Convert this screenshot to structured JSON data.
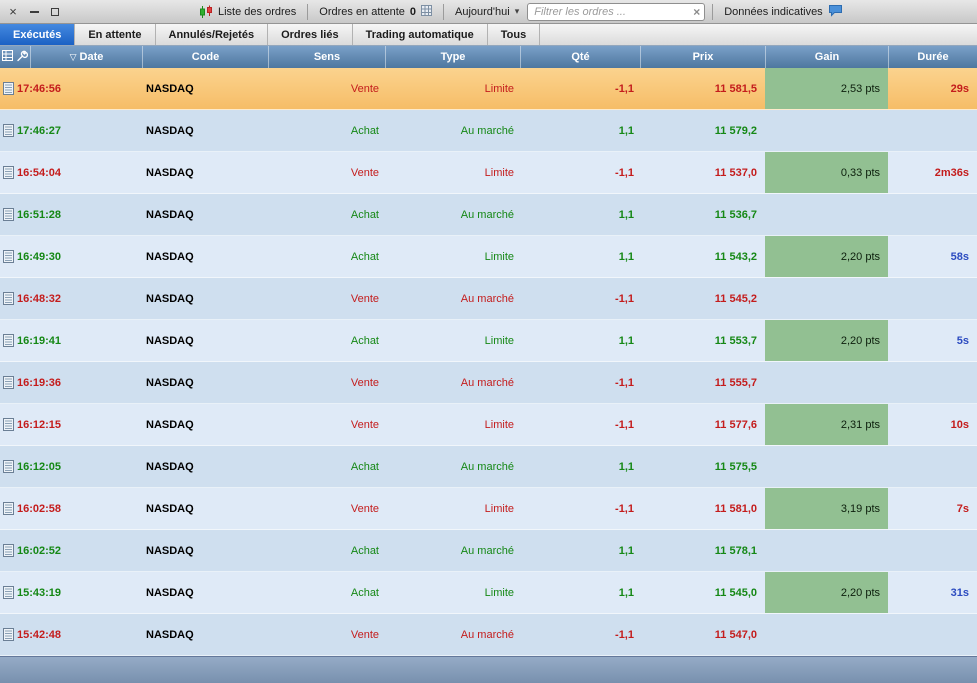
{
  "window": {
    "close_glyph": "×"
  },
  "toolbar": {
    "list_orders_label": "Liste des ordres",
    "pending_label": "Ordres en attente",
    "pending_count": "0",
    "period_label": "Aujourd'hui",
    "period_arrow": "▾",
    "filter_placeholder": "Filtrer les ordres ...",
    "filter_clear_glyph": "×",
    "indicative_label": "Données indicatives"
  },
  "tabs": [
    {
      "id": "executes",
      "label": "Exécutés",
      "active": true
    },
    {
      "id": "en-attente",
      "label": "En attente",
      "active": false
    },
    {
      "id": "annules-rejetes",
      "label": "Annulés/Rejetés",
      "active": false
    },
    {
      "id": "ordres-lies",
      "label": "Ordres liés",
      "active": false
    },
    {
      "id": "trading-automatique",
      "label": "Trading automatique",
      "active": false
    },
    {
      "id": "tous",
      "label": "Tous",
      "active": false
    }
  ],
  "table": {
    "sort_glyph": "▽",
    "columns": [
      {
        "key": "date",
        "label": "Date",
        "sorted": true
      },
      {
        "key": "code",
        "label": "Code"
      },
      {
        "key": "sens",
        "label": "Sens"
      },
      {
        "key": "type",
        "label": "Type"
      },
      {
        "key": "qte",
        "label": "Qté"
      },
      {
        "key": "prix",
        "label": "Prix"
      },
      {
        "key": "gain",
        "label": "Gain"
      },
      {
        "key": "duree",
        "label": "Durée"
      }
    ],
    "rows": [
      {
        "date": "17:46:56",
        "code": "NASDAQ",
        "sens": "Vente",
        "type": "Limite",
        "qte": "-1,1",
        "prix": "11 581,5",
        "gain": "2,53 pts",
        "duree": "29s",
        "side": "sell",
        "selected": true
      },
      {
        "date": "17:46:27",
        "code": "NASDAQ",
        "sens": "Achat",
        "type": "Au marché",
        "qte": "1,1",
        "prix": "11 579,2",
        "gain": "",
        "duree": "",
        "side": "buy",
        "selected": false
      },
      {
        "date": "16:54:04",
        "code": "NASDAQ",
        "sens": "Vente",
        "type": "Limite",
        "qte": "-1,1",
        "prix": "11 537,0",
        "gain": "0,33 pts",
        "duree": "2m36s",
        "side": "sell",
        "selected": false
      },
      {
        "date": "16:51:28",
        "code": "NASDAQ",
        "sens": "Achat",
        "type": "Au marché",
        "qte": "1,1",
        "prix": "11 536,7",
        "gain": "",
        "duree": "",
        "side": "buy",
        "selected": false
      },
      {
        "date": "16:49:30",
        "code": "NASDAQ",
        "sens": "Achat",
        "type": "Limite",
        "qte": "1,1",
        "prix": "11 543,2",
        "gain": "2,20 pts",
        "duree": "58s",
        "side": "buy",
        "selected": false
      },
      {
        "date": "16:48:32",
        "code": "NASDAQ",
        "sens": "Vente",
        "type": "Au marché",
        "qte": "-1,1",
        "prix": "11 545,2",
        "gain": "",
        "duree": "",
        "side": "sell",
        "selected": false
      },
      {
        "date": "16:19:41",
        "code": "NASDAQ",
        "sens": "Achat",
        "type": "Limite",
        "qte": "1,1",
        "prix": "11 553,7",
        "gain": "2,20 pts",
        "duree": "5s",
        "side": "buy",
        "selected": false
      },
      {
        "date": "16:19:36",
        "code": "NASDAQ",
        "sens": "Vente",
        "type": "Au marché",
        "qte": "-1,1",
        "prix": "11 555,7",
        "gain": "",
        "duree": "",
        "side": "sell",
        "selected": false
      },
      {
        "date": "16:12:15",
        "code": "NASDAQ",
        "sens": "Vente",
        "type": "Limite",
        "qte": "-1,1",
        "prix": "11 577,6",
        "gain": "2,31 pts",
        "duree": "10s",
        "side": "sell",
        "selected": false
      },
      {
        "date": "16:12:05",
        "code": "NASDAQ",
        "sens": "Achat",
        "type": "Au marché",
        "qte": "1,1",
        "prix": "11 575,5",
        "gain": "",
        "duree": "",
        "side": "buy",
        "selected": false
      },
      {
        "date": "16:02:58",
        "code": "NASDAQ",
        "sens": "Vente",
        "type": "Limite",
        "qte": "-1,1",
        "prix": "11 581,0",
        "gain": "3,19 pts",
        "duree": "7s",
        "side": "sell",
        "selected": false
      },
      {
        "date": "16:02:52",
        "code": "NASDAQ",
        "sens": "Achat",
        "type": "Au marché",
        "qte": "1,1",
        "prix": "11 578,1",
        "gain": "",
        "duree": "",
        "side": "buy",
        "selected": false
      },
      {
        "date": "15:43:19",
        "code": "NASDAQ",
        "sens": "Achat",
        "type": "Limite",
        "qte": "1,1",
        "prix": "11 545,0",
        "gain": "2,20 pts",
        "duree": "31s",
        "side": "buy",
        "selected": false
      },
      {
        "date": "15:42:48",
        "code": "NASDAQ",
        "sens": "Vente",
        "type": "Au marché",
        "qte": "-1,1",
        "prix": "11 547,0",
        "gain": "",
        "duree": "",
        "side": "sell",
        "selected": false
      }
    ]
  },
  "colors": {
    "sell": "#c41c1c",
    "buy": "#158815",
    "buy_duration": "#2b4bc0",
    "gain_bg": "#92c092",
    "selected_row_top": "#fbd38e",
    "selected_row_bottom": "#f6bd67",
    "header_top": "#7aa0c8",
    "header_bottom": "#4e779f",
    "active_tab_top": "#4489e0",
    "active_tab_bottom": "#1b61c4",
    "row_light": "#dfeaf7",
    "row_dark": "#cfdfef"
  }
}
